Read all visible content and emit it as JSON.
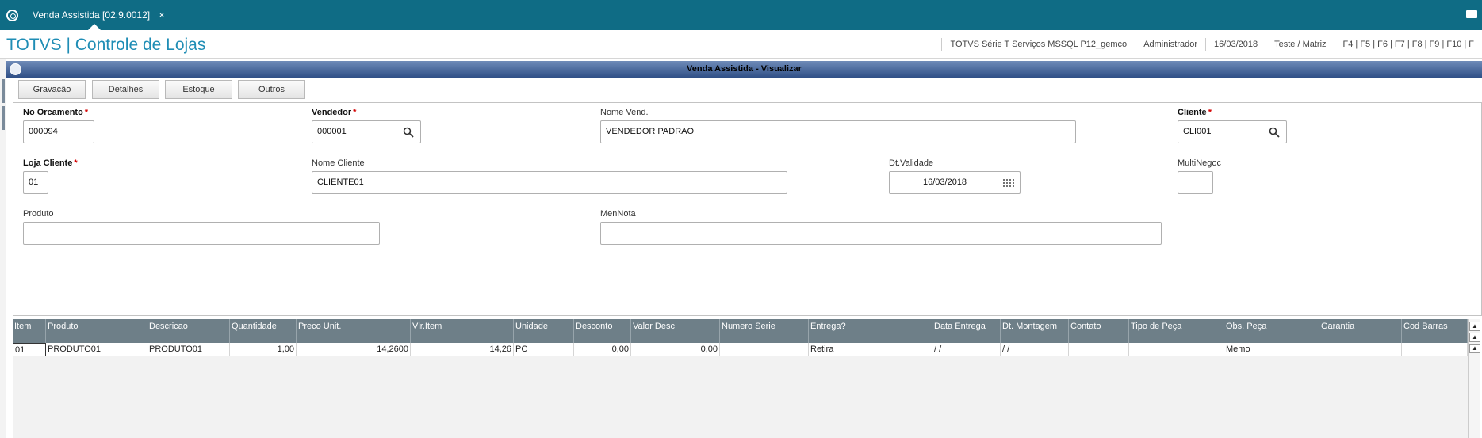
{
  "tab": {
    "title": "Venda Assistida [02.9.0012]",
    "close": "×"
  },
  "header": {
    "brand": "TOTVS | Controle de Lojas",
    "environment": "TOTVS Série T Serviços MSSQL P12_gemco",
    "user": "Administrador",
    "date": "16/03/2018",
    "branch": "Teste / Matriz",
    "shortcuts": "F4 | F5 | F6 | F7 | F8 | F9 | F10 | F"
  },
  "window": {
    "title": "Venda Assistida - Visualizar"
  },
  "toolbar": {
    "save": "Gravacão",
    "details": "Detalhes",
    "stock": "Estoque",
    "others": "Outros"
  },
  "form": {
    "orcamento": {
      "label": "No Orcamento",
      "required": "*",
      "value": "000094"
    },
    "vendedor": {
      "label": "Vendedor",
      "required": "*",
      "value": "000001"
    },
    "nome_vend": {
      "label": "Nome Vend.",
      "value": "VENDEDOR PADRAO"
    },
    "cliente": {
      "label": "Cliente",
      "required": "*",
      "value": "CLI001"
    },
    "loja_cliente": {
      "label": "Loja Cliente",
      "required": "*",
      "value": "01"
    },
    "nome_cliente": {
      "label": "Nome Cliente",
      "value": "CLIENTE01"
    },
    "dt_validade": {
      "label": "Dt.Validade",
      "value": "16/03/2018"
    },
    "multinegoc": {
      "label": "MultiNegoc",
      "value": ""
    },
    "produto": {
      "label": "Produto",
      "value": ""
    },
    "mennota": {
      "label": "MenNota",
      "value": ""
    }
  },
  "grid": {
    "headers": [
      "Item",
      "Produto",
      "Descricao",
      "Quantidade",
      "Preco Unit.",
      "Vlr.Item",
      "Unidade",
      "Desconto",
      "Valor Desc",
      "Numero Serie",
      "Entrega?",
      "Data Entrega",
      "Dt. Montagem",
      "Contato",
      "Tipo de Peça",
      "Obs. Peça",
      "Garantia",
      "Cod Barras"
    ],
    "rows": [
      [
        "01",
        "PRODUTO01",
        "PRODUTO01",
        "1,00",
        "14,2600",
        "14,26",
        "PC",
        "0,00",
        "0,00",
        "",
        "Retira",
        " /  /",
        " /  /",
        "",
        "",
        "Memo",
        "",
        ""
      ]
    ]
  },
  "icons": {
    "search": "search-icon",
    "calendar": "calendar-icon",
    "refresh": "refresh-icon",
    "mail": "mail-icon"
  }
}
